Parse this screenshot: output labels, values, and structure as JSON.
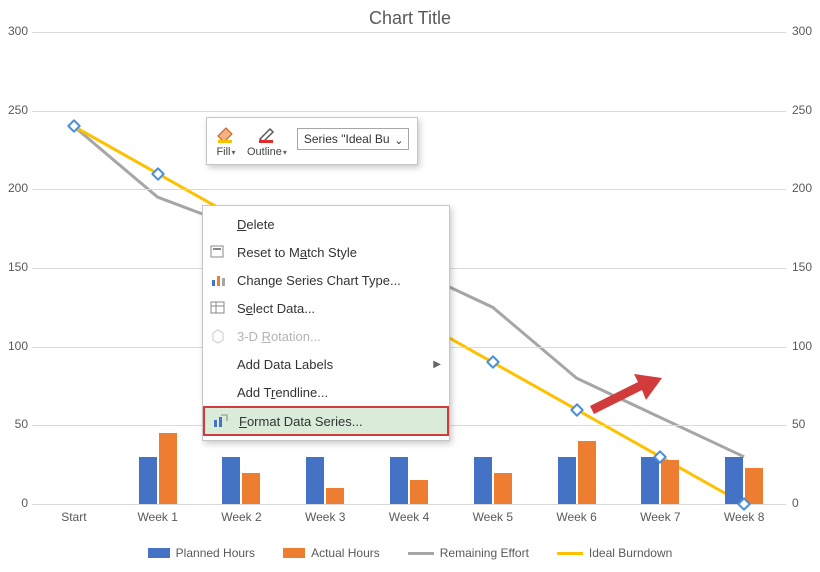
{
  "title": "Chart Title",
  "yaxis": {
    "min": 0,
    "max": 300,
    "step": 50,
    "ticks": [
      0,
      50,
      100,
      150,
      200,
      250,
      300
    ]
  },
  "categories": [
    "Start",
    "Week 1",
    "Week 2",
    "Week 3",
    "Week 4",
    "Week 5",
    "Week 6",
    "Week 7",
    "Week 8"
  ],
  "chart_data": {
    "type": "bar+line",
    "categories": [
      "Start",
      "Week 1",
      "Week 2",
      "Week 3",
      "Week 4",
      "Week 5",
      "Week 6",
      "Week 7",
      "Week 8"
    ],
    "ylim": [
      0,
      300
    ],
    "series": [
      {
        "name": "Planned Hours",
        "type": "bar",
        "color": "#4472c4",
        "values": [
          null,
          30,
          30,
          30,
          30,
          30,
          30,
          30,
          30
        ]
      },
      {
        "name": "Actual Hours",
        "type": "bar",
        "color": "#ed7d31",
        "values": [
          null,
          45,
          20,
          10,
          15,
          20,
          40,
          28,
          23
        ]
      },
      {
        "name": "Remaining Effort",
        "type": "line",
        "color": "#a6a6a6",
        "values": [
          240,
          195,
          175,
          165,
          150,
          125,
          80,
          55,
          30
        ]
      },
      {
        "name": "Ideal Burndown",
        "type": "line",
        "color": "#ffc000",
        "values": [
          240,
          210,
          180,
          150,
          120,
          90,
          60,
          30,
          0
        ]
      }
    ]
  },
  "legend": {
    "planned": "Planned Hours",
    "actual": "Actual Hours",
    "remaining": "Remaining Effort",
    "ideal": "Ideal Burndown"
  },
  "colors": {
    "planned": "#4472c4",
    "actual": "#ed7d31",
    "remaining": "#a6a6a6",
    "ideal": "#ffc000",
    "marker": "#4a8fd9"
  },
  "mini_toolbar": {
    "fill": "Fill",
    "outline": "Outline",
    "selected_series": "Series \"Ideal Bu"
  },
  "context_menu": {
    "delete": "Delete",
    "reset": "Reset to Match Style",
    "change_type": "Change Series Chart Type...",
    "select_data": "Select Data...",
    "rotation": "3-D Rotation...",
    "add_labels": "Add Data Labels",
    "add_trendline": "Add Trendline...",
    "format_series": "Format Data Series..."
  }
}
